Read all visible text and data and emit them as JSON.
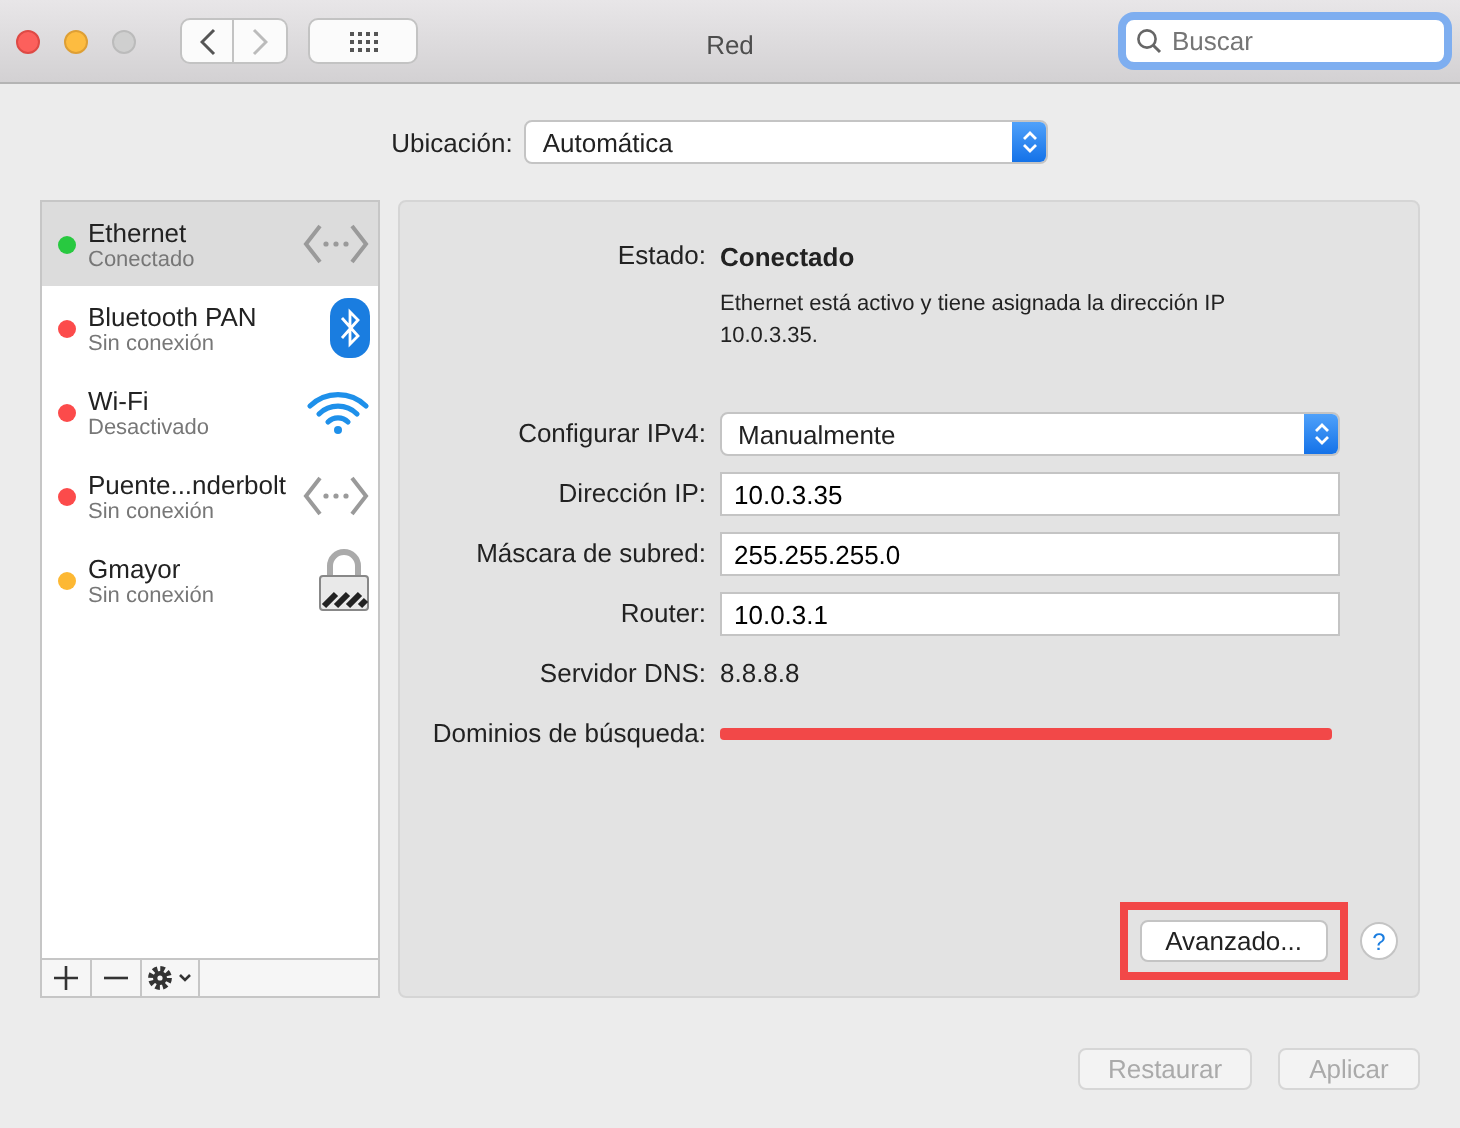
{
  "window": {
    "title": "Red",
    "back_disabled": false,
    "forward_disabled": true
  },
  "search": {
    "placeholder": "Buscar",
    "focused": true
  },
  "location": {
    "label": "Ubicación:",
    "value": "Automática"
  },
  "services": [
    {
      "name": "Ethernet",
      "status": "Conectado",
      "color": "#28c940",
      "selected": true,
      "kind": "ethernet"
    },
    {
      "name": "Bluetooth PAN",
      "status": "Sin conexión",
      "color": "#fc4b4b",
      "selected": false,
      "kind": "bluetooth"
    },
    {
      "name": "Wi-Fi",
      "status": "Desactivado",
      "color": "#fc4b4b",
      "selected": false,
      "kind": "wifi"
    },
    {
      "name": "Puente...nderbolt",
      "status": "Sin conexión",
      "color": "#fc4b4b",
      "selected": false,
      "kind": "ethernet"
    },
    {
      "name": "Gmayor",
      "status": "Sin conexión",
      "color": "#fdb833",
      "selected": false,
      "kind": "vpn"
    }
  ],
  "details": {
    "status_label": "Estado:",
    "status": "Conectado",
    "description": "Ethernet está activo y tiene asignada la dirección IP 10.0.3.35.",
    "fields": [
      {
        "kind": "select",
        "label": "Configurar IPv4:",
        "value": "Manualmente"
      },
      {
        "kind": "input",
        "label": "Dirección IP:",
        "value": "10.0.3.35"
      },
      {
        "kind": "input",
        "label": "Máscara de subred:",
        "value": "255.255.255.0"
      },
      {
        "kind": "input",
        "label": "Router:",
        "value": "10.0.3.1"
      },
      {
        "kind": "text",
        "label": "Servidor DNS:",
        "value": "8.8.8.8"
      },
      {
        "kind": "redacted",
        "label": "Dominios de búsqueda:"
      }
    ],
    "advanced": {
      "label": "Avanzado...",
      "highlighted": true
    },
    "help": "?"
  },
  "buttons": [
    {
      "label": "Restaurar",
      "disabled": true
    },
    {
      "label": "Aplicar",
      "disabled": true
    }
  ]
}
